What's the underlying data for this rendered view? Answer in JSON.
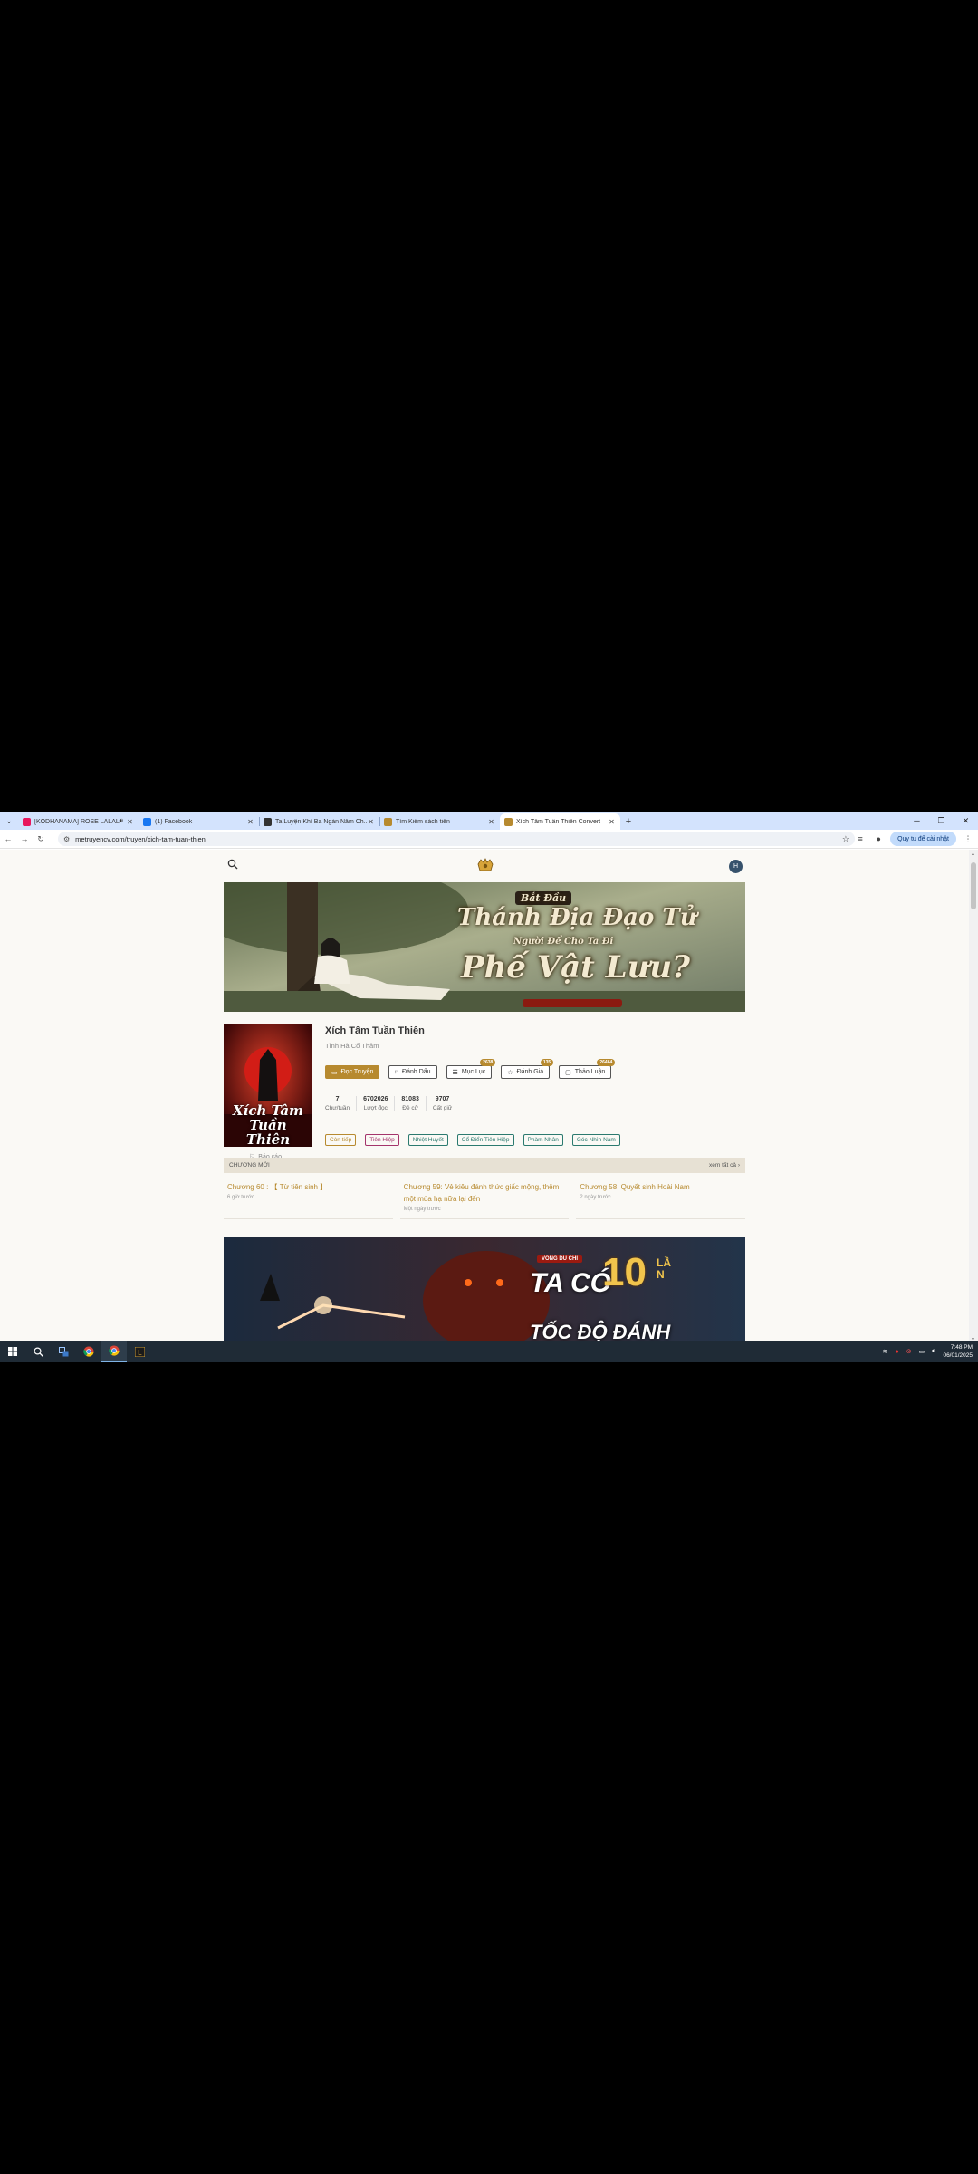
{
  "browser": {
    "tabs": [
      {
        "title": "[KODHANAMA] ROSE LALALA",
        "favicon_color": "#e8175d",
        "muted": true
      },
      {
        "title": "(1) Facebook",
        "favicon_color": "#1877f2"
      },
      {
        "title": "Ta Luyện Khí Ba Ngàn Năm Ch...",
        "favicon_color": "#333333"
      },
      {
        "title": "Tìm Kiếm sách tiên",
        "favicon_color": "#b78a2f"
      },
      {
        "title": "Xích Tâm Tuần Thiên Convert",
        "favicon_color": "#b78a2f",
        "active": true
      }
    ],
    "url": "metruyencv.com/truyen/xich-tam-tuan-thien",
    "profile_label": "Quy tu để cài nhật"
  },
  "site": {
    "avatar_letter": "H",
    "banner_top": {
      "line1": "Bắt Đầu",
      "line2": "Thánh Địa Đạo Tử",
      "line3": "Người Để Cho Ta Đi",
      "line4": "Phế Vật Lưu?"
    },
    "book": {
      "title": "Xích Tâm Tuần Thiên",
      "author": "Tình Hà Cổ Thâm",
      "cover_text": "Xích Tâm Tuần Thiên",
      "report_label": "Báo cáo",
      "actions": [
        {
          "label": "Đọc Truyện",
          "icon": "book-open-icon",
          "primary": true
        },
        {
          "label": "Đánh Dấu",
          "icon": "bookmark-icon"
        },
        {
          "label": "Mục Lục",
          "icon": "list-icon",
          "badge": "2638"
        },
        {
          "label": "Đánh Giá",
          "icon": "star-icon",
          "badge": "135"
        },
        {
          "label": "Thảo Luận",
          "icon": "chat-icon",
          "badge": "26464"
        }
      ],
      "stats": [
        {
          "value": "7",
          "label": "Chư/tuần"
        },
        {
          "value": "6702026",
          "label": "Lượt đọc"
        },
        {
          "value": "81083",
          "label": "Đề cử"
        },
        {
          "value": "9707",
          "label": "Cất giữ"
        }
      ],
      "tags": [
        {
          "label": "Còn tiếp",
          "color": "#b78a2f"
        },
        {
          "label": "Tiên Hiệp",
          "color": "#a4346b"
        },
        {
          "label": "Nhiệt Huyết",
          "color": "#2b7a6f"
        },
        {
          "label": "Cổ Điển Tiên Hiệp",
          "color": "#2b7a6f"
        },
        {
          "label": "Phàm Nhân",
          "color": "#2b7a6f"
        },
        {
          "label": "Góc Nhìn Nam",
          "color": "#2b7a6f"
        }
      ]
    },
    "new_chapters": {
      "heading": "CHƯƠNG MỚI",
      "see_all": "xem tất cả",
      "items": [
        {
          "title": "Chương 60 : 【 Từ tiên sinh 】",
          "time": "6 giờ trước"
        },
        {
          "title": "Chương 59: Vẻ kiêu đánh thức giấc mộng, thêm một mùa hạ nữa lại đến",
          "time": "Một ngày trước"
        },
        {
          "title": "Chương 58: Quyết sinh Hoài Nam",
          "time": "2 ngày trước"
        }
      ]
    },
    "banner_bottom": {
      "badge": "VÕNG DU CHI",
      "line1": "TA CÓ",
      "num": "10",
      "suffix": "LẦN",
      "line2": "TỐC ĐỘ ĐÁNH"
    }
  },
  "taskbar": {
    "time": "7:48 PM",
    "date": "06/01/2025"
  }
}
